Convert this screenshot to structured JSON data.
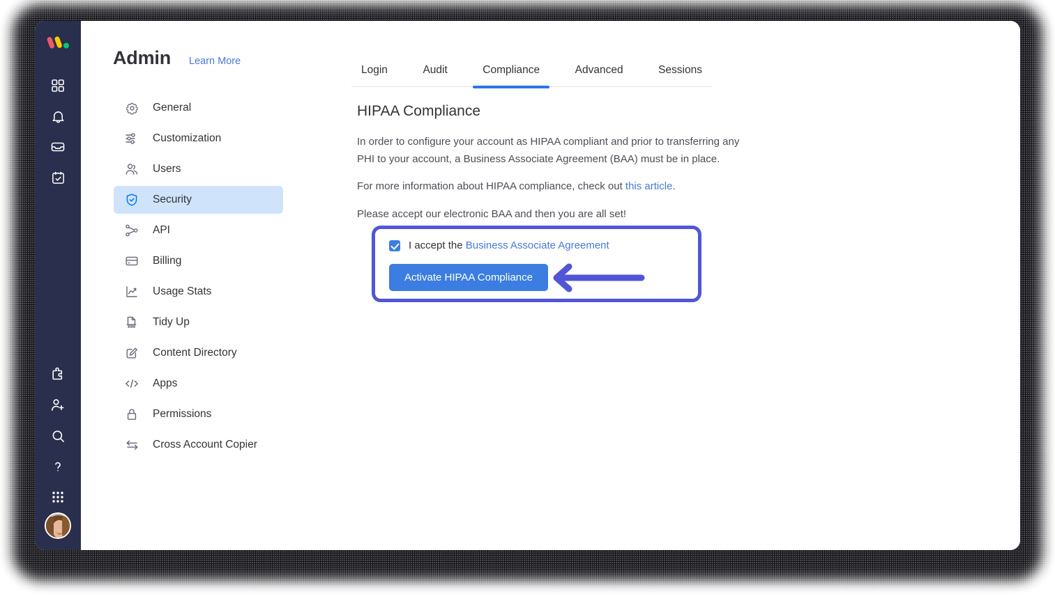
{
  "rail": {
    "logo_name": "monday-logo",
    "logo_colors": [
      "#f0586b",
      "#ffcb00",
      "#00ca72"
    ],
    "top_icons": [
      {
        "name": "grid-icon",
        "label": "Home"
      },
      {
        "name": "bell-icon",
        "label": "Notifications"
      },
      {
        "name": "inbox-icon",
        "label": "Inbox"
      },
      {
        "name": "calendar-check-icon",
        "label": "My Work"
      }
    ],
    "bottom_icons": [
      {
        "name": "puzzle-icon",
        "label": "Apps"
      },
      {
        "name": "invite-user-icon",
        "label": "Invite Members"
      },
      {
        "name": "search-icon",
        "label": "Search"
      },
      {
        "name": "help-icon",
        "label": "Help"
      },
      {
        "name": "dots-grid-icon",
        "label": "Products"
      }
    ],
    "avatar_name": "user-avatar"
  },
  "header": {
    "title": "Admin",
    "learn_more": "Learn More"
  },
  "sidebar": {
    "items": [
      {
        "label": "General",
        "icon": "gear-icon",
        "active": false
      },
      {
        "label": "Customization",
        "icon": "sliders-icon",
        "active": false
      },
      {
        "label": "Users",
        "icon": "users-icon",
        "active": false
      },
      {
        "label": "Security",
        "icon": "shield-check-icon",
        "active": true
      },
      {
        "label": "API",
        "icon": "nodes-icon",
        "active": false
      },
      {
        "label": "Billing",
        "icon": "credit-card-icon",
        "active": false
      },
      {
        "label": "Usage Stats",
        "icon": "chart-line-icon",
        "active": false
      },
      {
        "label": "Tidy Up",
        "icon": "tidy-up-icon",
        "active": false
      },
      {
        "label": "Content Directory",
        "icon": "edit-document-icon",
        "active": false
      },
      {
        "label": "Apps",
        "icon": "code-icon",
        "active": false
      },
      {
        "label": "Permissions",
        "icon": "lock-icon",
        "active": false
      },
      {
        "label": "Cross Account Copier",
        "icon": "transfer-icon",
        "active": false
      }
    ]
  },
  "tabs": [
    {
      "label": "Login",
      "active": false
    },
    {
      "label": "Audit",
      "active": false
    },
    {
      "label": "Compliance",
      "active": true
    },
    {
      "label": "Advanced",
      "active": false
    },
    {
      "label": "Sessions",
      "active": false
    }
  ],
  "panel": {
    "title": "HIPAA Compliance",
    "paragraph_1": "In order to configure your account as HIPAA compliant and prior to transferring any PHI to your account, a Business Associate Agreement (BAA) must be in place.",
    "paragraph_2_prefix": "For more information about HIPAA compliance, check out ",
    "paragraph_2_link": "this article",
    "paragraph_2_suffix": ".",
    "paragraph_3": "Please accept our electronic BAA and then you are all set!"
  },
  "baa": {
    "accept_prefix": "I accept the ",
    "accept_link": "Business Associate Agreement",
    "checkbox_checked": true,
    "activate_label": "Activate HIPAA Compliance"
  },
  "annotation": {
    "highlight_color": "#5056d6",
    "arrow_color": "#5056d6",
    "arrow_direction": "left",
    "points_at": "activate-hipaa-compliance-button"
  },
  "colors": {
    "primary_blue": "#3b7de0",
    "tab_active_blue": "#2b76e5",
    "link_blue": "#4a79d6",
    "rail_bg": "#292f4c",
    "active_nav_bg": "#cfe3fb"
  }
}
